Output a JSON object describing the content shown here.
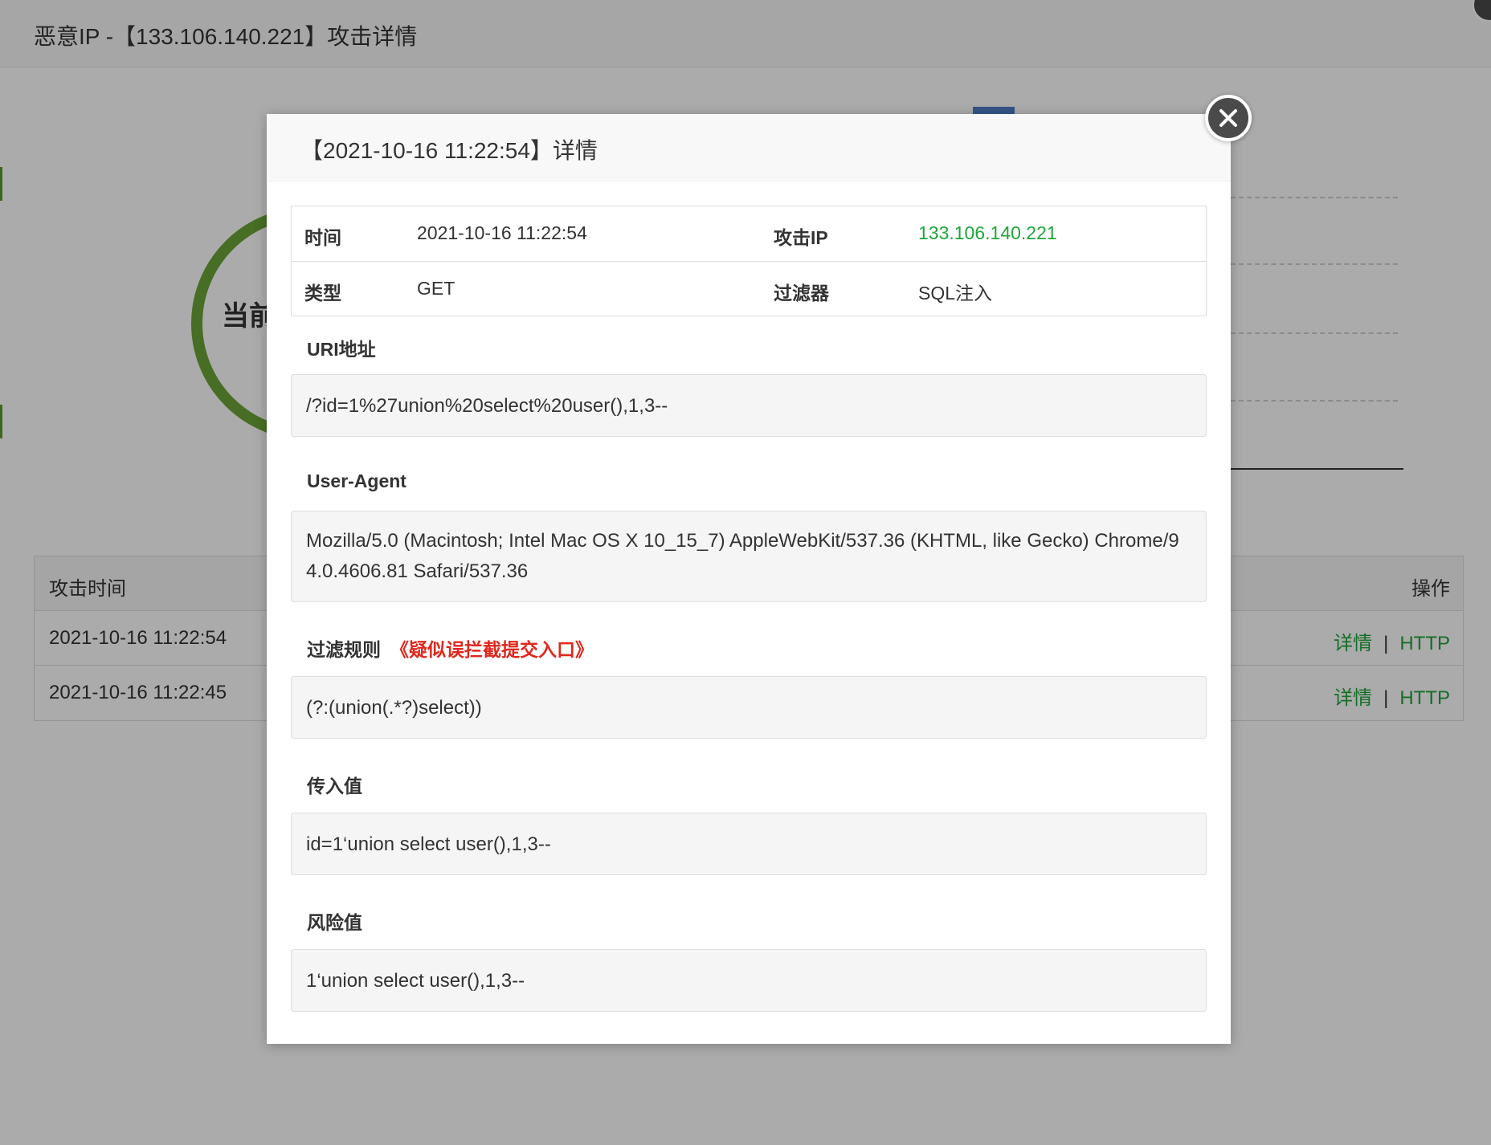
{
  "outer": {
    "title": "恶意IP -【133.106.140.221】攻击详情",
    "ring_text": "当前",
    "table": {
      "header_time": "攻击时间",
      "header_ops": "操作",
      "rows": [
        {
          "time": "2021-10-16 11:22:54",
          "link1": "详情",
          "sep": "|",
          "link2": "HTTP"
        },
        {
          "time": "2021-10-16 11:22:45",
          "link1": "详情",
          "sep": "|",
          "link2": "HTTP"
        }
      ]
    }
  },
  "modal": {
    "title": "【2021-10-16 11:22:54】详情",
    "info": {
      "time_label": "时间",
      "time_value": "2021-10-16 11:22:54",
      "ip_label": "攻击IP",
      "ip_value": "133.106.140.221",
      "type_label": "类型",
      "type_value": "GET",
      "filter_label": "过滤器",
      "filter_value": "SQL注入"
    },
    "uri": {
      "label": "URI地址",
      "value": "/?id=1%27union%20select%20user(),1,3--"
    },
    "user_agent": {
      "label": "User-Agent",
      "value": "Mozilla/5.0 (Macintosh; Intel Mac OS X 10_15_7) AppleWebKit/537.36 (KHTML, like Gecko) Chrome/94.0.4606.81 Safari/537.36"
    },
    "rule": {
      "label": "过滤规则",
      "warning": "《疑似误拦截提交入口》",
      "value": "(?:(union(.*?)select))"
    },
    "input_value": {
      "label": "传入值",
      "value": "id=1‘union select user(),1,3--"
    },
    "risk_value": {
      "label": "风险值",
      "value": "1‘union select user(),1,3--"
    }
  },
  "colors": {
    "accent_green": "#20a53a",
    "warning_red": "#e0271d",
    "ring_green": "#6aa437"
  },
  "icons": {
    "modal_close": "close-icon"
  }
}
